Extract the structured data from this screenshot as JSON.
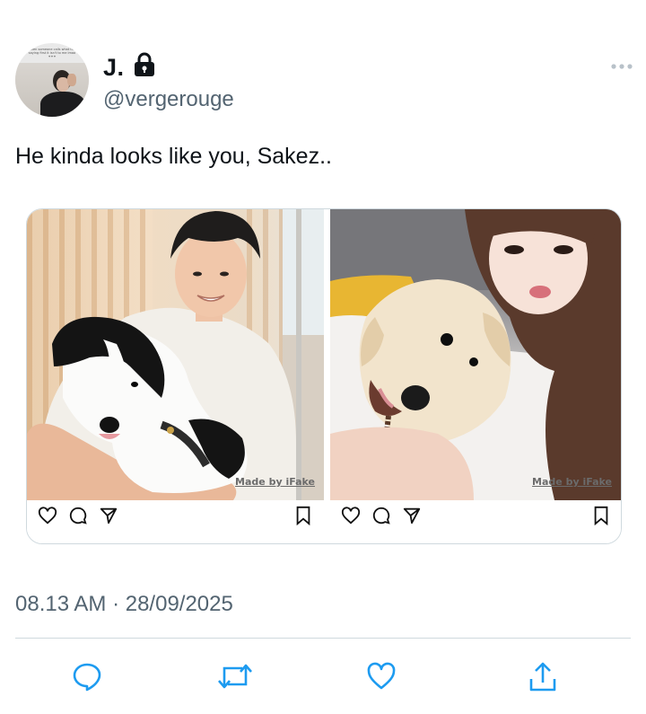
{
  "author": {
    "display_name": "J.",
    "handle": "@vergerouge",
    "avatar_caption": "when someone calls what the saying first it isn't to me lmao ✦✦✦",
    "protected": true
  },
  "tweet": {
    "text": "He kinda looks like you, Sakez.."
  },
  "media": {
    "posts": [
      {
        "watermark": "Made by iFake",
        "icons": [
          "heart-icon",
          "comment-icon",
          "share-icon",
          "bookmark-icon"
        ]
      },
      {
        "watermark": "Made by iFake",
        "icons": [
          "heart-icon",
          "comment-icon",
          "share-icon",
          "bookmark-icon"
        ]
      }
    ]
  },
  "meta": {
    "timestamp": "08.13 AM · 28/09/2025"
  },
  "actions": {
    "icons": [
      "reply-icon",
      "retweet-icon",
      "like-icon",
      "share-icon"
    ]
  },
  "colors": {
    "text": "#0f1419",
    "secondary": "#536471",
    "accent": "#1d9bf0",
    "border": "#cfd9de"
  }
}
